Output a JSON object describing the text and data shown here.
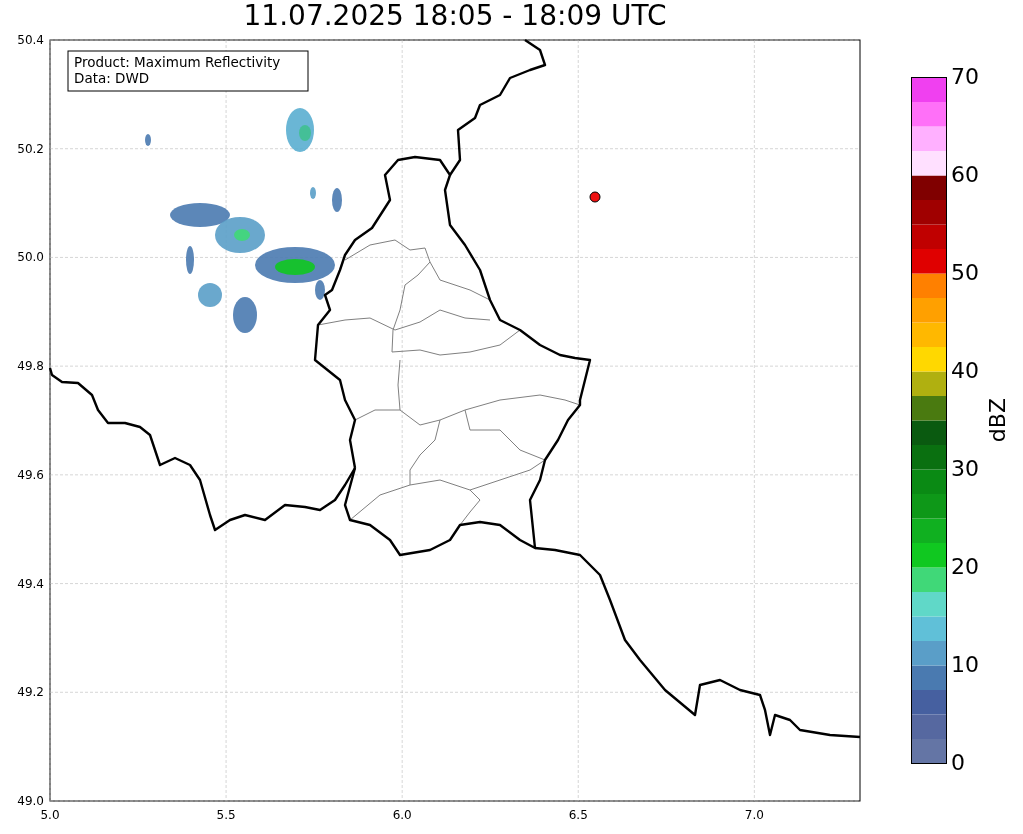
{
  "title": "11.07.2025 18:05 - 18:09 UTC",
  "map": {
    "info_lines": [
      "Product: Maximum Reflectivity",
      "Data: DWD"
    ],
    "grid": true,
    "xticks": [
      "5.0",
      "5.5",
      "6.0",
      "6.5",
      "7.0"
    ],
    "yticks": [
      "50.4",
      "50.2",
      "50.0",
      "49.8",
      "49.6",
      "49.4",
      "49.2",
      "49.0"
    ]
  },
  "colorbar": {
    "label": "dBZ",
    "ticks": [
      "70",
      "60",
      "50",
      "40",
      "30",
      "20",
      "10",
      "0"
    ]
  }
}
